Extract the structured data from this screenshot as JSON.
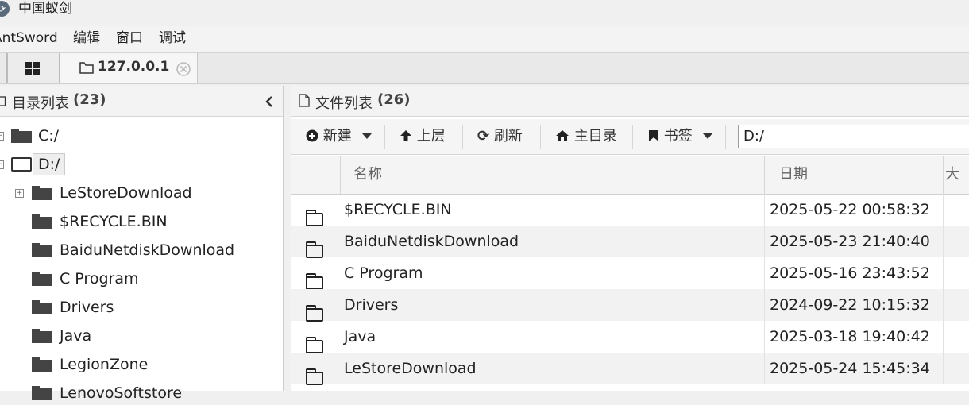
{
  "window": {
    "title": "中国蚁剑"
  },
  "menubar": {
    "items": [
      "AntSword",
      "编辑",
      "窗口",
      "调试"
    ]
  },
  "tabs": {
    "grid_icon": "grid-icon",
    "host_tab": {
      "label": "127.0.0.1",
      "icon": "folder-icon",
      "close_icon": "close-icon"
    }
  },
  "left_panel": {
    "title": "目录列表",
    "count": "(23)",
    "tree": [
      {
        "label": "C:/",
        "level": 0,
        "expanded": false
      },
      {
        "label": "D:/",
        "level": 0,
        "expanded": true,
        "selected": true
      },
      {
        "label": "LeStoreDownload",
        "level": 1,
        "has_children": true
      },
      {
        "label": "$RECYCLE.BIN",
        "level": 1
      },
      {
        "label": "BaiduNetdiskDownload",
        "level": 1
      },
      {
        "label": "C Program",
        "level": 1
      },
      {
        "label": "Drivers",
        "level": 1
      },
      {
        "label": "Java",
        "level": 1
      },
      {
        "label": "LegionZone",
        "level": 1
      },
      {
        "label": "LenovoSoftstore",
        "level": 1
      }
    ]
  },
  "right_panel": {
    "title": "文件列表",
    "count": "(26)",
    "toolbar": {
      "new_label": "新建",
      "up_label": "上层",
      "refresh_label": "刷新",
      "home_label": "主目录",
      "bookmark_label": "书签",
      "path_value": "D:/"
    },
    "columns": {
      "name": "名称",
      "date": "日期",
      "size": "大"
    },
    "rows": [
      {
        "name": "$RECYCLE.BIN",
        "date": "2025-05-22 00:58:32"
      },
      {
        "name": "BaiduNetdiskDownload",
        "date": "2025-05-23 21:40:40"
      },
      {
        "name": "C Program",
        "date": "2025-05-16 23:43:52"
      },
      {
        "name": "Drivers",
        "date": "2024-09-22 10:15:32"
      },
      {
        "name": "Java",
        "date": "2025-03-18 19:40:42"
      },
      {
        "name": "LeStoreDownload",
        "date": "2025-05-24 15:45:34"
      }
    ]
  }
}
